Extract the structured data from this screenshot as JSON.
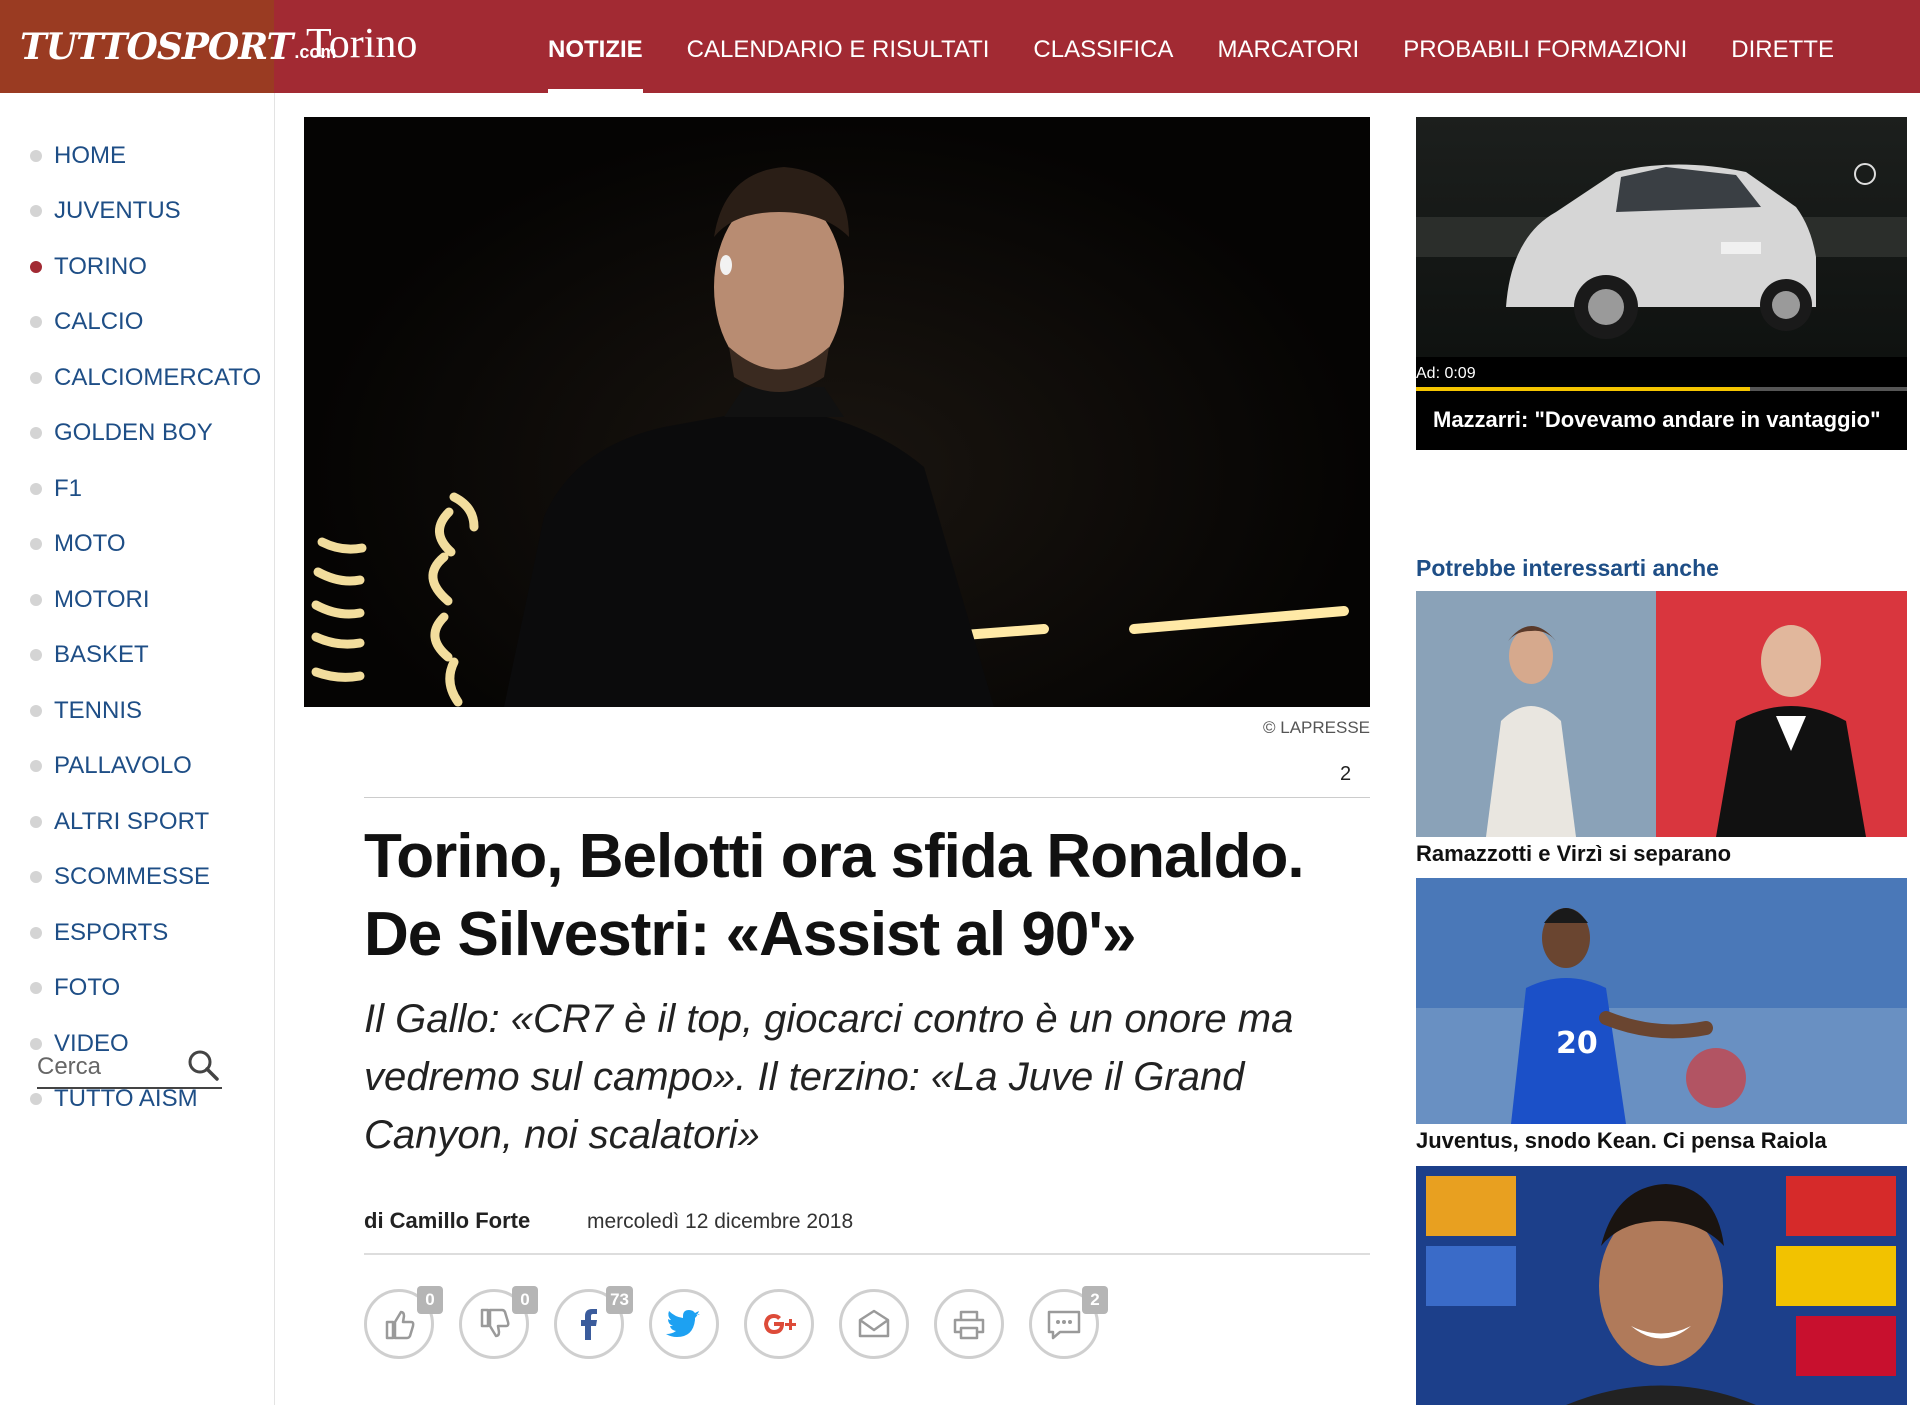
{
  "header": {
    "logo_text": "TUTTOSPORT",
    "logo_domain": ".com",
    "section": "Torino",
    "nav": [
      {
        "label": "NOTIZIE",
        "active": true
      },
      {
        "label": "CALENDARIO E RISULTATI",
        "active": false
      },
      {
        "label": "CLASSIFICA",
        "active": false
      },
      {
        "label": "MARCATORI",
        "active": false
      },
      {
        "label": "PROBABILI FORMAZIONI",
        "active": false
      },
      {
        "label": "DIRETTE",
        "active": false
      }
    ]
  },
  "sidebar": {
    "items": [
      {
        "label": "HOME",
        "active": false
      },
      {
        "label": "JUVENTUS",
        "active": false
      },
      {
        "label": "TORINO",
        "active": true
      },
      {
        "label": "CALCIO",
        "active": false
      },
      {
        "label": "CALCIOMERCATO",
        "active": false
      },
      {
        "label": "GOLDEN BOY",
        "active": false
      },
      {
        "label": "F1",
        "active": false
      },
      {
        "label": "MOTO",
        "active": false
      },
      {
        "label": "MOTORI",
        "active": false
      },
      {
        "label": "BASKET",
        "active": false
      },
      {
        "label": "TENNIS",
        "active": false
      },
      {
        "label": "PALLAVOLO",
        "active": false
      },
      {
        "label": "ALTRI SPORT",
        "active": false
      },
      {
        "label": "SCOMMESSE",
        "active": false
      },
      {
        "label": "ESPORTS",
        "active": false
      },
      {
        "label": "FOTO",
        "active": false
      },
      {
        "label": "VIDEO",
        "active": false
      },
      {
        "label": "TUTTO AISM",
        "active": false
      }
    ],
    "search_placeholder": "Cerca"
  },
  "article": {
    "photo_credit": "© LAPRESSE",
    "comment_count": "2",
    "headline_line1": "Torino, Belotti ora sfida Ronaldo.",
    "headline_line2": "De Silvestri: «Assist al 90'»",
    "subtitle": "Il Gallo: «CR7 è il top, giocarci contro è un onore ma vedremo sul campo». Il terzino: «La Juve il Grand Canyon, noi scalatori»",
    "byline": "di Camillo Forte",
    "date": "mercoledì 12 dicembre 2018",
    "social": [
      {
        "icon": "thumbs-up-icon",
        "count": "0"
      },
      {
        "icon": "thumbs-down-icon",
        "count": "0"
      },
      {
        "icon": "facebook-icon",
        "count": "73"
      },
      {
        "icon": "twitter-icon",
        "count": ""
      },
      {
        "icon": "google-plus-icon",
        "count": ""
      },
      {
        "icon": "email-icon",
        "count": ""
      },
      {
        "icon": "print-icon",
        "count": ""
      },
      {
        "icon": "comment-icon",
        "count": "2"
      }
    ]
  },
  "right": {
    "video": {
      "ad_label": "Ad: 0:09",
      "progress": 0.68,
      "title": "Mazzarri: \"Dovevamo andare in vantaggio\""
    },
    "related_heading": "Potrebbe interessarti anche",
    "related": [
      {
        "title": "Ramazzotti e Virzì si separano"
      },
      {
        "title": "Juventus, snodo Kean. Ci pensa Raiola"
      }
    ]
  },
  "colors": {
    "brand_red": "#a22a33",
    "logo_bg": "#9a3b22",
    "link_blue": "#1e4e86"
  }
}
